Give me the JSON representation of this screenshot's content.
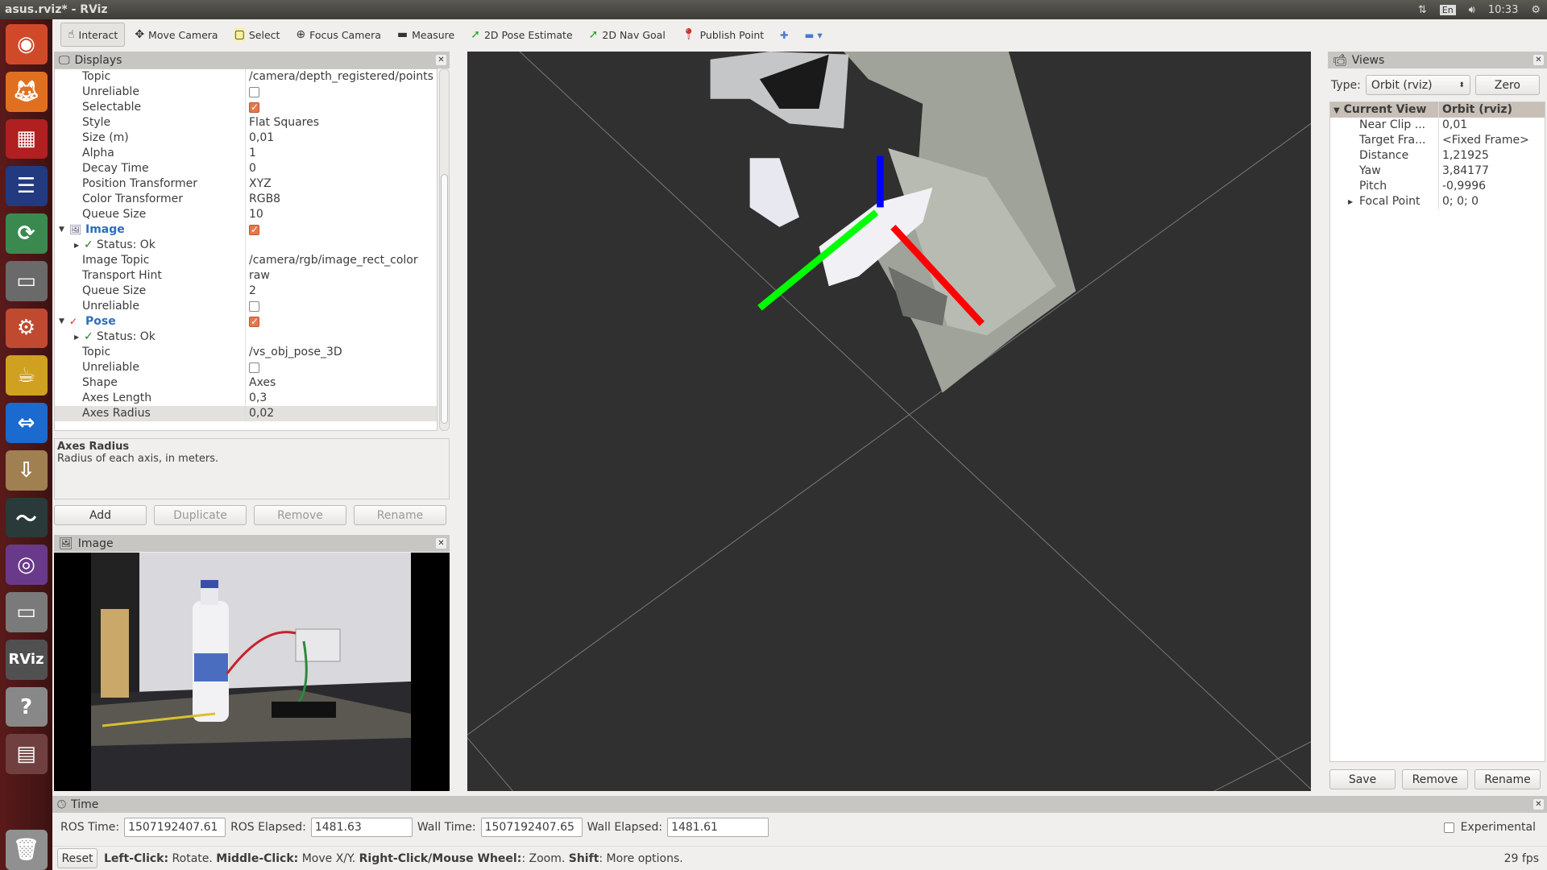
{
  "window": {
    "title": "asus.rviz* - RViz"
  },
  "tray": {
    "lang": "En",
    "clock": "10:33"
  },
  "launcher": {
    "items": [
      "ubuntu-dash",
      "firefox",
      "media-app",
      "eclipse",
      "system-monitor-app",
      "files",
      "settings",
      "teapot-app",
      "teamviewer",
      "downloader",
      "system-monitor",
      "webcam-app",
      "files-2",
      "rviz",
      "help",
      "workspace-switcher",
      "trash"
    ]
  },
  "toolbar": {
    "tools": [
      {
        "label": "Interact",
        "icon": "hand-icon",
        "active": true
      },
      {
        "label": "Move Camera",
        "icon": "move-camera-icon"
      },
      {
        "label": "Select",
        "icon": "select-icon"
      },
      {
        "label": "Focus Camera",
        "icon": "focus-camera-icon"
      },
      {
        "label": "Measure",
        "icon": "ruler-icon"
      },
      {
        "label": "2D Pose Estimate",
        "icon": "green-arrow-icon"
      },
      {
        "label": "2D Nav Goal",
        "icon": "green-arrow-icon"
      },
      {
        "label": "Publish Point",
        "icon": "map-pin-icon"
      }
    ]
  },
  "displays": {
    "title": "Displays",
    "rows": [
      {
        "k": "Topic",
        "v": "/camera/depth_registered/points"
      },
      {
        "k": "Unreliable",
        "cb": false
      },
      {
        "k": "Selectable",
        "cb": true
      },
      {
        "k": "Style",
        "v": "Flat Squares"
      },
      {
        "k": "Size (m)",
        "v": "0,01"
      },
      {
        "k": "Alpha",
        "v": "1"
      },
      {
        "k": "Decay Time",
        "v": "0"
      },
      {
        "k": "Position Transformer",
        "v": "XYZ"
      },
      {
        "k": "Color Transformer",
        "v": "RGB8"
      },
      {
        "k": "Queue Size",
        "v": "10"
      },
      {
        "k": "Image",
        "cb": true,
        "group": true
      },
      {
        "k": "Status: Ok",
        "status": true
      },
      {
        "k": "Image Topic",
        "v": "/camera/rgb/image_rect_color"
      },
      {
        "k": "Transport Hint",
        "v": "raw"
      },
      {
        "k": "Queue Size",
        "v": "2"
      },
      {
        "k": "Unreliable",
        "cb": false
      },
      {
        "k": "Pose",
        "cb": true,
        "group": true
      },
      {
        "k": "Status: Ok",
        "status": true
      },
      {
        "k": "Topic",
        "v": "/vs_obj_pose_3D"
      },
      {
        "k": "Unreliable",
        "cb": false
      },
      {
        "k": "Shape",
        "v": "Axes"
      },
      {
        "k": "Axes Length",
        "v": "0,3"
      },
      {
        "k": "Axes Radius",
        "v": "0,02",
        "selected": true
      }
    ],
    "desc_title": "Axes Radius",
    "desc_text": "Radius of each axis, in meters.",
    "buttons": {
      "add": "Add",
      "duplicate": "Duplicate",
      "remove": "Remove",
      "rename": "Rename"
    }
  },
  "image_panel": {
    "title": "Image"
  },
  "views": {
    "title": "Views",
    "type_label": "Type:",
    "type_value": "Orbit (rviz)",
    "zero": "Zero",
    "header_k": "Current View",
    "header_v": "Orbit (rviz)",
    "rows": [
      {
        "k": "Near Clip ...",
        "v": "0,01"
      },
      {
        "k": "Target Fra...",
        "v": "<Fixed Frame>"
      },
      {
        "k": "Distance",
        "v": "1,21925"
      },
      {
        "k": "Yaw",
        "v": "3,84177"
      },
      {
        "k": "Pitch",
        "v": "-0,9996"
      },
      {
        "k": "Focal Point",
        "v": "0; 0; 0",
        "expand": true
      }
    ],
    "buttons": {
      "save": "Save",
      "remove": "Remove",
      "rename": "Rename"
    }
  },
  "time": {
    "title": "Time",
    "ros_time_label": "ROS Time:",
    "ros_time": "1507192407.61",
    "ros_elapsed_label": "ROS Elapsed:",
    "ros_elapsed": "1481.63",
    "wall_time_label": "Wall Time:",
    "wall_time": "1507192407.65",
    "wall_elapsed_label": "Wall Elapsed:",
    "wall_elapsed": "1481.61",
    "experimental": "Experimental",
    "experimental_checked": false
  },
  "status": {
    "reset": "Reset",
    "h1": "Left-Click:",
    "t1": " Rotate. ",
    "h2": "Middle-Click:",
    "t2": " Move X/Y. ",
    "h3": "Right-Click/Mouse Wheel:",
    "t3": ": Zoom. ",
    "h4": "Shift",
    "t4": ": More options.",
    "fps": "29 fps"
  },
  "colors": {
    "axis_x": "#ff0000",
    "axis_y": "#00ff00",
    "axis_z": "#0000ff",
    "background": "#303030",
    "group_text": "#2c6ebf",
    "check": "#e8764a"
  }
}
